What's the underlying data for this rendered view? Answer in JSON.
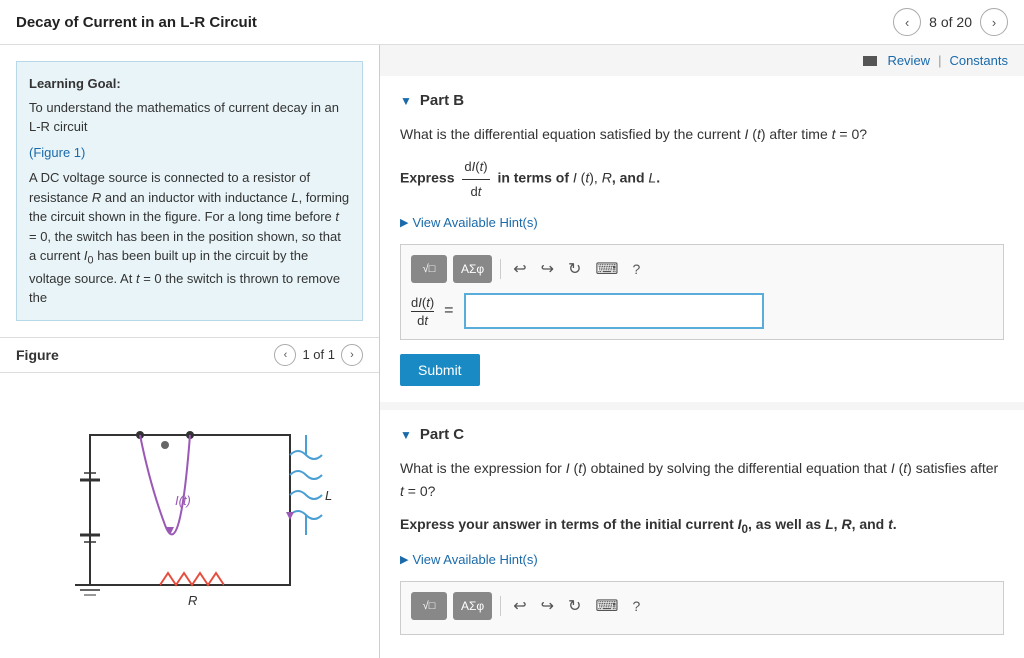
{
  "header": {
    "title": "Decay of Current in an L-R Circuit",
    "nav_counter": "8 of 20",
    "prev_label": "‹",
    "next_label": "›"
  },
  "top_links": {
    "review_label": "Review",
    "constants_label": "Constants",
    "separator": "|"
  },
  "left_panel": {
    "learning_goal_title": "Learning Goal:",
    "learning_goal_text": "To understand the mathematics of current decay in an L-R circuit",
    "figure_link": "(Figure 1)",
    "body_text": "A DC voltage source is connected to a resistor of resistance R and an inductor with inductance L, forming the circuit shown in the figure. For a long time before t = 0, the switch has been in the position shown, so that a current I₀ has been built up in the circuit by the voltage source. At t = 0 the switch is thrown to remove the",
    "figure_title": "Figure",
    "figure_counter": "1 of 1"
  },
  "part_b": {
    "title": "Part B",
    "question": "What is the differential equation satisfied by the current I (t) after time t = 0?",
    "express_prefix": "Express",
    "fraction_num": "dI(t)",
    "fraction_den": "dt",
    "express_suffix": "in terms of I (t), R, and L.",
    "hint_label": "View Available Hint(s)",
    "equation_lhs_num": "dI(t)",
    "equation_lhs_den": "dt",
    "submit_label": "Submit"
  },
  "part_c": {
    "title": "Part C",
    "question": "What is the expression for I (t) obtained by solving the differential equation that I (t) satisfies after t = 0?",
    "express_label": "Express your answer in terms of the initial current I₀, as well as L, R, and t.",
    "hint_label": "View Available Hint(s)"
  },
  "toolbar": {
    "btn1": "√□",
    "btn2": "ΑΣφ",
    "undo_icon": "↩",
    "redo_icon": "↪",
    "reset_icon": "↻",
    "keyboard_icon": "⌨",
    "help_icon": "?"
  },
  "colors": {
    "accent_blue": "#1a8ac4",
    "link_blue": "#1a6aaa",
    "input_border": "#5aacdb",
    "learning_bg": "#e8f4f8"
  }
}
